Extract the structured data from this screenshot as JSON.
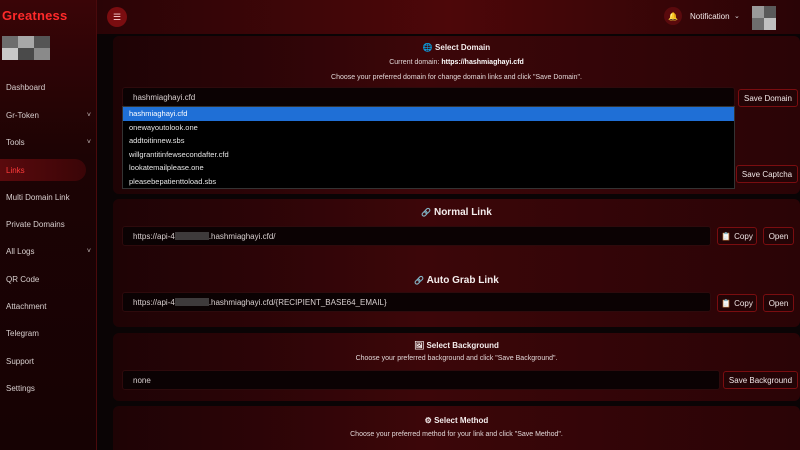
{
  "brand": "Greatness",
  "topbar": {
    "notification_label": "Notification"
  },
  "sidebar": {
    "items": [
      {
        "label": "Dashboard",
        "chevron": false
      },
      {
        "label": "Gr-Token",
        "chevron": true
      },
      {
        "label": "Tools",
        "chevron": true
      },
      {
        "label": "Links",
        "chevron": false,
        "active": true
      },
      {
        "label": "Multi Domain Link",
        "chevron": false
      },
      {
        "label": "Private Domains",
        "chevron": false
      },
      {
        "label": "All Logs",
        "chevron": true
      },
      {
        "label": "QR Code",
        "chevron": false
      },
      {
        "label": "Attachment",
        "chevron": false
      },
      {
        "label": "Telegram",
        "chevron": false
      },
      {
        "label": "Support",
        "chevron": false
      },
      {
        "label": "Settings",
        "chevron": false
      }
    ]
  },
  "select_domain": {
    "title": "Select Domain",
    "current_label": "Current domain:",
    "current_value": "https://hashmiaghayi.cfd",
    "instruction": "Choose your preferred domain for change domain links and click \"Save Domain\".",
    "selected": "hashmiaghayi.cfd",
    "save_button": "Save Domain",
    "options": [
      "hashmiaghayi.cfd",
      "onewayoutolook.one",
      "addtoitinnew.sbs",
      "willgrantitinfewsecondafter.cfd",
      "lookatemailplease.one",
      "pleasebepatienttoload.sbs"
    ]
  },
  "captcha": {
    "save_button": "Save Captcha"
  },
  "normal_link": {
    "title": "Normal Link",
    "url_prefix": "https://api-4",
    "url_suffix": ".hashmiaghayi.cfd/",
    "copy": "Copy",
    "open": "Open"
  },
  "auto_grab": {
    "title": "Auto Grab Link",
    "url_prefix": "https://api-4",
    "url_suffix": ".hashmiaghayi.cfd/{RECIPIENT_BASE64_EMAIL}",
    "copy": "Copy",
    "open": "Open"
  },
  "background": {
    "title": "Select Background",
    "instruction": "Choose your preferred background and click \"Save Background\".",
    "value": "none",
    "save_button": "Save Background"
  },
  "method": {
    "title": "Select Method",
    "instruction": "Choose your preferred method for your link and click \"Save Method\"."
  },
  "colors": {
    "accent": "#ff2a2a",
    "selection": "#1f6fd6"
  }
}
